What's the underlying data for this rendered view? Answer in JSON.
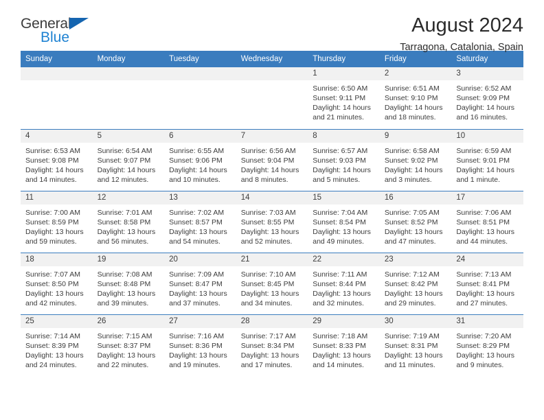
{
  "brand": {
    "name_top": "General",
    "name_bottom": "Blue",
    "triangle_color": "#1565b0",
    "blue_text_color": "#1e82d2"
  },
  "header": {
    "title": "August 2024",
    "location": "Tarragona, Catalonia, Spain"
  },
  "calendar": {
    "header_bg": "#3a7cbe",
    "daynum_bg": "#f1f1f1",
    "weekdays": [
      "Sunday",
      "Monday",
      "Tuesday",
      "Wednesday",
      "Thursday",
      "Friday",
      "Saturday"
    ],
    "weeks": [
      [
        {
          "day": "",
          "empty": true
        },
        {
          "day": "",
          "empty": true
        },
        {
          "day": "",
          "empty": true
        },
        {
          "day": "",
          "empty": true
        },
        {
          "day": "1",
          "sunrise": "Sunrise: 6:50 AM",
          "sunset": "Sunset: 9:11 PM",
          "daylight1": "Daylight: 14 hours",
          "daylight2": "and 21 minutes."
        },
        {
          "day": "2",
          "sunrise": "Sunrise: 6:51 AM",
          "sunset": "Sunset: 9:10 PM",
          "daylight1": "Daylight: 14 hours",
          "daylight2": "and 18 minutes."
        },
        {
          "day": "3",
          "sunrise": "Sunrise: 6:52 AM",
          "sunset": "Sunset: 9:09 PM",
          "daylight1": "Daylight: 14 hours",
          "daylight2": "and 16 minutes."
        }
      ],
      [
        {
          "day": "4",
          "sunrise": "Sunrise: 6:53 AM",
          "sunset": "Sunset: 9:08 PM",
          "daylight1": "Daylight: 14 hours",
          "daylight2": "and 14 minutes."
        },
        {
          "day": "5",
          "sunrise": "Sunrise: 6:54 AM",
          "sunset": "Sunset: 9:07 PM",
          "daylight1": "Daylight: 14 hours",
          "daylight2": "and 12 minutes."
        },
        {
          "day": "6",
          "sunrise": "Sunrise: 6:55 AM",
          "sunset": "Sunset: 9:06 PM",
          "daylight1": "Daylight: 14 hours",
          "daylight2": "and 10 minutes."
        },
        {
          "day": "7",
          "sunrise": "Sunrise: 6:56 AM",
          "sunset": "Sunset: 9:04 PM",
          "daylight1": "Daylight: 14 hours",
          "daylight2": "and 8 minutes."
        },
        {
          "day": "8",
          "sunrise": "Sunrise: 6:57 AM",
          "sunset": "Sunset: 9:03 PM",
          "daylight1": "Daylight: 14 hours",
          "daylight2": "and 5 minutes."
        },
        {
          "day": "9",
          "sunrise": "Sunrise: 6:58 AM",
          "sunset": "Sunset: 9:02 PM",
          "daylight1": "Daylight: 14 hours",
          "daylight2": "and 3 minutes."
        },
        {
          "day": "10",
          "sunrise": "Sunrise: 6:59 AM",
          "sunset": "Sunset: 9:01 PM",
          "daylight1": "Daylight: 14 hours",
          "daylight2": "and 1 minute."
        }
      ],
      [
        {
          "day": "11",
          "sunrise": "Sunrise: 7:00 AM",
          "sunset": "Sunset: 8:59 PM",
          "daylight1": "Daylight: 13 hours",
          "daylight2": "and 59 minutes."
        },
        {
          "day": "12",
          "sunrise": "Sunrise: 7:01 AM",
          "sunset": "Sunset: 8:58 PM",
          "daylight1": "Daylight: 13 hours",
          "daylight2": "and 56 minutes."
        },
        {
          "day": "13",
          "sunrise": "Sunrise: 7:02 AM",
          "sunset": "Sunset: 8:57 PM",
          "daylight1": "Daylight: 13 hours",
          "daylight2": "and 54 minutes."
        },
        {
          "day": "14",
          "sunrise": "Sunrise: 7:03 AM",
          "sunset": "Sunset: 8:55 PM",
          "daylight1": "Daylight: 13 hours",
          "daylight2": "and 52 minutes."
        },
        {
          "day": "15",
          "sunrise": "Sunrise: 7:04 AM",
          "sunset": "Sunset: 8:54 PM",
          "daylight1": "Daylight: 13 hours",
          "daylight2": "and 49 minutes."
        },
        {
          "day": "16",
          "sunrise": "Sunrise: 7:05 AM",
          "sunset": "Sunset: 8:52 PM",
          "daylight1": "Daylight: 13 hours",
          "daylight2": "and 47 minutes."
        },
        {
          "day": "17",
          "sunrise": "Sunrise: 7:06 AM",
          "sunset": "Sunset: 8:51 PM",
          "daylight1": "Daylight: 13 hours",
          "daylight2": "and 44 minutes."
        }
      ],
      [
        {
          "day": "18",
          "sunrise": "Sunrise: 7:07 AM",
          "sunset": "Sunset: 8:50 PM",
          "daylight1": "Daylight: 13 hours",
          "daylight2": "and 42 minutes."
        },
        {
          "day": "19",
          "sunrise": "Sunrise: 7:08 AM",
          "sunset": "Sunset: 8:48 PM",
          "daylight1": "Daylight: 13 hours",
          "daylight2": "and 39 minutes."
        },
        {
          "day": "20",
          "sunrise": "Sunrise: 7:09 AM",
          "sunset": "Sunset: 8:47 PM",
          "daylight1": "Daylight: 13 hours",
          "daylight2": "and 37 minutes."
        },
        {
          "day": "21",
          "sunrise": "Sunrise: 7:10 AM",
          "sunset": "Sunset: 8:45 PM",
          "daylight1": "Daylight: 13 hours",
          "daylight2": "and 34 minutes."
        },
        {
          "day": "22",
          "sunrise": "Sunrise: 7:11 AM",
          "sunset": "Sunset: 8:44 PM",
          "daylight1": "Daylight: 13 hours",
          "daylight2": "and 32 minutes."
        },
        {
          "day": "23",
          "sunrise": "Sunrise: 7:12 AM",
          "sunset": "Sunset: 8:42 PM",
          "daylight1": "Daylight: 13 hours",
          "daylight2": "and 29 minutes."
        },
        {
          "day": "24",
          "sunrise": "Sunrise: 7:13 AM",
          "sunset": "Sunset: 8:41 PM",
          "daylight1": "Daylight: 13 hours",
          "daylight2": "and 27 minutes."
        }
      ],
      [
        {
          "day": "25",
          "sunrise": "Sunrise: 7:14 AM",
          "sunset": "Sunset: 8:39 PM",
          "daylight1": "Daylight: 13 hours",
          "daylight2": "and 24 minutes."
        },
        {
          "day": "26",
          "sunrise": "Sunrise: 7:15 AM",
          "sunset": "Sunset: 8:37 PM",
          "daylight1": "Daylight: 13 hours",
          "daylight2": "and 22 minutes."
        },
        {
          "day": "27",
          "sunrise": "Sunrise: 7:16 AM",
          "sunset": "Sunset: 8:36 PM",
          "daylight1": "Daylight: 13 hours",
          "daylight2": "and 19 minutes."
        },
        {
          "day": "28",
          "sunrise": "Sunrise: 7:17 AM",
          "sunset": "Sunset: 8:34 PM",
          "daylight1": "Daylight: 13 hours",
          "daylight2": "and 17 minutes."
        },
        {
          "day": "29",
          "sunrise": "Sunrise: 7:18 AM",
          "sunset": "Sunset: 8:33 PM",
          "daylight1": "Daylight: 13 hours",
          "daylight2": "and 14 minutes."
        },
        {
          "day": "30",
          "sunrise": "Sunrise: 7:19 AM",
          "sunset": "Sunset: 8:31 PM",
          "daylight1": "Daylight: 13 hours",
          "daylight2": "and 11 minutes."
        },
        {
          "day": "31",
          "sunrise": "Sunrise: 7:20 AM",
          "sunset": "Sunset: 8:29 PM",
          "daylight1": "Daylight: 13 hours",
          "daylight2": "and 9 minutes."
        }
      ]
    ]
  }
}
